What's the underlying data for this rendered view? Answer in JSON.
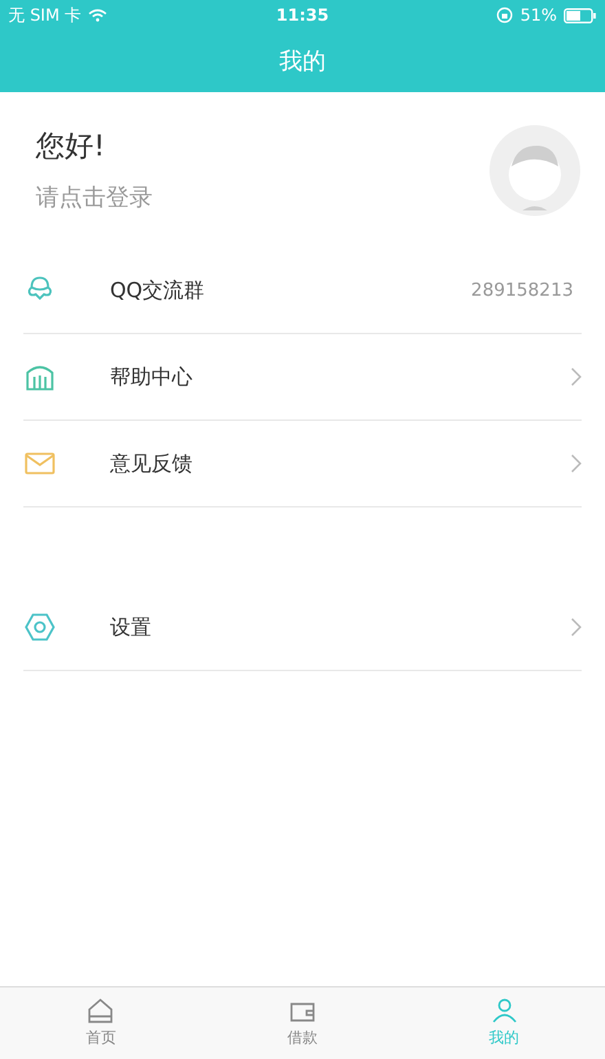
{
  "status_bar": {
    "carrier": "无 SIM 卡",
    "time": "11:35",
    "battery": "51%"
  },
  "header": {
    "title": "我的"
  },
  "profile": {
    "greeting": "您好!",
    "prompt": "请点击登录"
  },
  "sections": [
    {
      "items": [
        {
          "label": "QQ交流群",
          "kind": "value",
          "value": "289158213",
          "color": "#4cc3bd"
        },
        {
          "label": "帮助中心",
          "kind": "link",
          "color": "#4cc3a4"
        },
        {
          "label": "意见反馈",
          "kind": "link",
          "color": "#f0c060"
        }
      ]
    },
    {
      "items": [
        {
          "label": "设置",
          "kind": "link",
          "color": "#4cc3c8"
        }
      ]
    }
  ],
  "tabs": [
    {
      "label": "首页",
      "selected": false
    },
    {
      "label": "借款",
      "selected": false
    },
    {
      "label": "我的",
      "selected": true
    }
  ]
}
